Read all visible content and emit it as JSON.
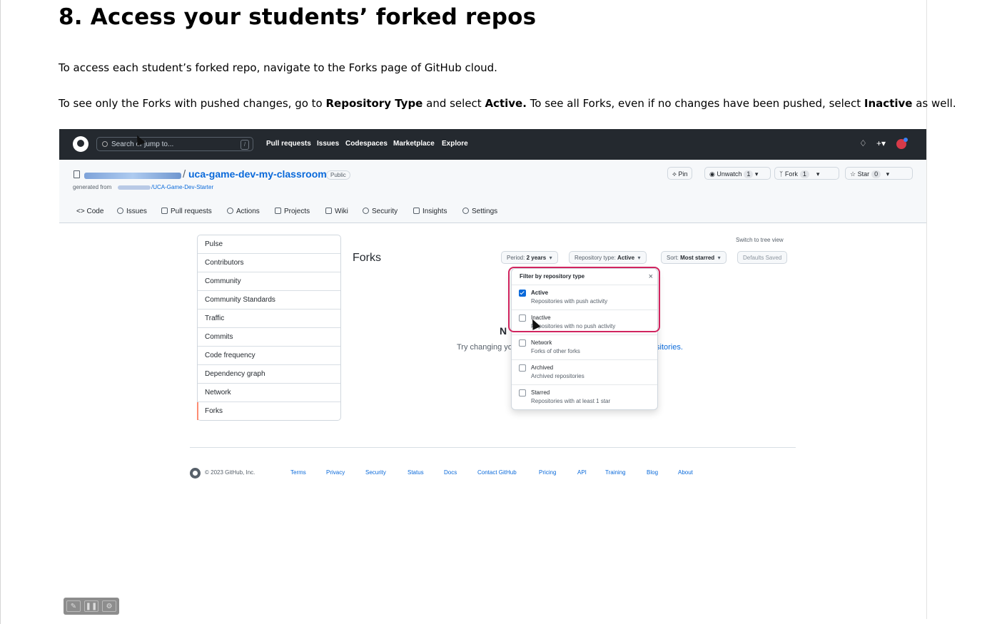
{
  "doc": {
    "heading": "8. Access your students’ forked repos",
    "p1": "To access each student’s forked repo, navigate to the Forks page of GitHub cloud.",
    "p2_a": "To see only the Forks with pushed changes, go to ",
    "p2_b": "Repository Type",
    "p2_c": " and select ",
    "p2_d": "Active.",
    "p2_e": " To see all Forks, even if no changes have been pushed, select ",
    "p2_f": "Inactive",
    "p2_g": " as well."
  },
  "gh": {
    "search_placeholder": "Search or jump to...",
    "search_key": "/",
    "nav": [
      "Pull requests",
      "Issues",
      "Codespaces",
      "Marketplace",
      "Explore"
    ],
    "repo_name": "uca-game-dev-my-classroom",
    "repo_visibility": "Public",
    "generated_from_label": "generated from",
    "generated_from_repo": "/UCA-Game-Dev-Starter",
    "repo_buttons": {
      "pin": "Pin",
      "unwatch": "Unwatch",
      "unwatch_count": "1",
      "fork": "Fork",
      "fork_count": "1",
      "star": "Star",
      "star_count": "0"
    },
    "tabs": [
      "Code",
      "Issues",
      "Pull requests",
      "Actions",
      "Projects",
      "Wiki",
      "Security",
      "Insights",
      "Settings"
    ],
    "sidenav": [
      "Pulse",
      "Contributors",
      "Community",
      "Community Standards",
      "Traffic",
      "Commits",
      "Code frequency",
      "Dependency graph",
      "Network",
      "Forks"
    ],
    "forks_title": "Forks",
    "tree_view": "Switch to tree view",
    "filters": {
      "period_label": "Period:",
      "period_value": "2 years",
      "repo_type_label": "Repository type:",
      "repo_type_value": "Active",
      "sort_label": "Sort:",
      "sort_value": "Most starred",
      "defaults": "Defaults Saved"
    },
    "empty_title_fragment": "N",
    "empty_text_fragment": "Try changing yo",
    "empty_link_fragment": "sitories.",
    "dropdown": {
      "title": "Filter by repository type",
      "close": "×",
      "items": [
        {
          "label": "Active",
          "desc": "Repositories with push activity",
          "checked": true
        },
        {
          "label": "Inactive",
          "desc": "Repositories with no push activity",
          "checked": false
        },
        {
          "label": "Network",
          "desc": "Forks of other forks",
          "checked": false
        },
        {
          "label": "Archived",
          "desc": "Archived repositories",
          "checked": false
        },
        {
          "label": "Starred",
          "desc": "Repositories with at least 1 star",
          "checked": false
        }
      ]
    },
    "footer": {
      "copyright": "© 2023 GitHub, Inc.",
      "links": [
        "Terms",
        "Privacy",
        "Security",
        "Status",
        "Docs",
        "Contact GitHub",
        "Pricing",
        "API",
        "Training",
        "Blog",
        "About"
      ]
    }
  },
  "player": {
    "buttons": [
      "edit-icon",
      "pause-icon",
      "settings-icon"
    ]
  }
}
